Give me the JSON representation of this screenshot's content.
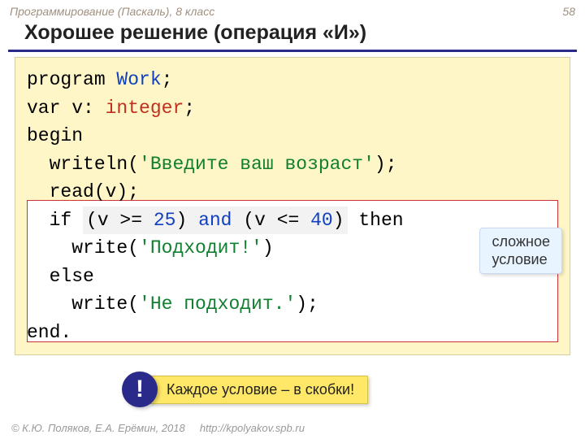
{
  "header": {
    "course": "Программирование (Паскаль), 8 класс",
    "page": "58"
  },
  "title": "Хорошее решение (операция «И»)",
  "code": {
    "l1_program": "program ",
    "l1_name": "Work",
    "semi": ";",
    "l2_var": "var v: ",
    "l2_type": "integer",
    "l3": "begin",
    "l4_a": "  writeln(",
    "l4_str": "'Введите ваш возраст'",
    "l4_b": ");",
    "l5": "  read(v);",
    "l6_a": "  if ",
    "l6_b": "(v >= ",
    "l6_n1": "25",
    "l6_c": ") ",
    "l6_and": "and",
    "l6_d": " (v <= ",
    "l6_n2": "40",
    "l6_e": ")",
    "l6_f": " then",
    "l7_a": "    write(",
    "l7_str": "'Подходит!'",
    "l7_b": ")",
    "l8": "  else",
    "l9_a": "    write(",
    "l9_str": "'Не подходит.'",
    "l9_b": ");",
    "l10": "end."
  },
  "callout": {
    "line1": "сложное",
    "line2": "условие"
  },
  "tip": {
    "mark": "!",
    "text": "Каждое условие – в скобки!"
  },
  "footer": {
    "copyright": "© К.Ю. Поляков, Е.А. Ерёмин, 2018",
    "url": "http://kpolyakov.spb.ru"
  }
}
